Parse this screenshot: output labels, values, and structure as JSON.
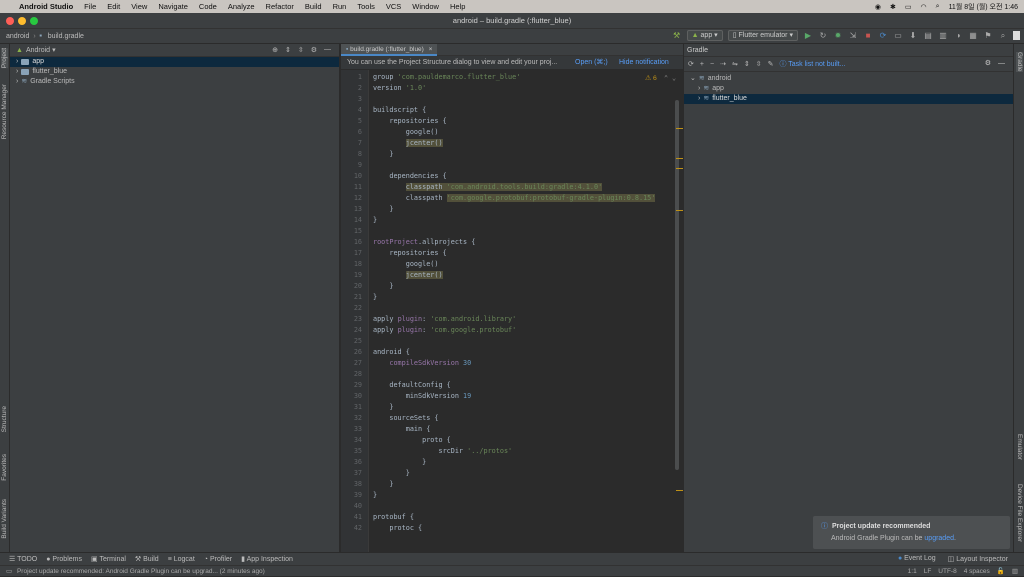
{
  "mac_menu": {
    "apple": "",
    "app_name": "Android Studio",
    "items": [
      "File",
      "Edit",
      "View",
      "Navigate",
      "Code",
      "Analyze",
      "Refactor",
      "Build",
      "Run",
      "Tools",
      "VCS",
      "Window",
      "Help"
    ],
    "datetime": "11월 8일 (월) 오전 1:46"
  },
  "window": {
    "title": "android – build.gradle (:flutter_blue)"
  },
  "navbar": {
    "breadcrumb_root": "android",
    "breadcrumb_file": "build.gradle",
    "run_config": "app",
    "device": "Flutter emulator"
  },
  "left_strip": {
    "project": "Project",
    "resource_manager": "Resource Manager",
    "structure": "Structure",
    "favorites": "Favorites",
    "build_variants": "Build Variants"
  },
  "right_strip": {
    "gradle": "Gradle",
    "emulator": "Emulator",
    "device_explorer": "Device File Explorer"
  },
  "project_panel": {
    "view": "Android",
    "tree": [
      {
        "label": "app",
        "selected": true
      },
      {
        "label": "flutter_blue",
        "selected": false
      },
      {
        "label": "Gradle Scripts",
        "selected": false
      }
    ]
  },
  "editor": {
    "tab": "build.gradle (:flutter_blue)",
    "banner_text": "You can use the Project Structure dialog to view and edit your proj...",
    "banner_open": "Open (⌘;)",
    "banner_hide": "Hide notification",
    "warnings": "⚠ 6",
    "line_numbers": [
      "1",
      "2",
      "3",
      "4",
      "5",
      "6",
      "7",
      "8",
      "9",
      "10",
      "11",
      "12",
      "13",
      "14",
      "15",
      "16",
      "17",
      "18",
      "19",
      "20",
      "21",
      "22",
      "23",
      "24",
      "25",
      "26",
      "27",
      "28",
      "29",
      "30",
      "31",
      "32",
      "33",
      "34",
      "35",
      "36",
      "37",
      "38",
      "39",
      "40",
      "41",
      "42"
    ],
    "code": {
      "l1a": "group ",
      "l1b": "'com.pauldemarco.flutter_blue'",
      "l2a": "version ",
      "l2b": "'1.0'",
      "l4": "buildscript {",
      "l5": "    repositories {",
      "l6": "        google()",
      "l7": "jcenter()",
      "l8": "    }",
      "l10": "    dependencies {",
      "l11a": "classpath ",
      "l11b": "'com.android.tools.build:gradle:4.1.0'",
      "l12a": "classpath ",
      "l12b": "'com.google.protobuf:protobuf-gradle-plugin:0.8.15'",
      "l13": "    }",
      "l14": "}",
      "l16a": "rootProject",
      "l16b": ".allprojects {",
      "l17": "    repositories {",
      "l18": "        google()",
      "l19": "jcenter()",
      "l20": "    }",
      "l21": "}",
      "l23a": "apply ",
      "l23b": "plugin",
      "l23c": ": ",
      "l23d": "'com.android.library'",
      "l24a": "apply ",
      "l24b": "plugin",
      "l24c": ": ",
      "l24d": "'com.google.protobuf'",
      "l26": "android {",
      "l27a": "    compileSdkVersion ",
      "l27b": "30",
      "l29": "    defaultConfig {",
      "l30a": "        minSdkVersion ",
      "l30b": "19",
      "l31": "    }",
      "l32": "    sourceSets {",
      "l33": "        main {",
      "l34": "            proto {",
      "l35a": "                srcDir ",
      "l35b": "'../protos'",
      "l36": "            }",
      "l37": "        }",
      "l38": "    }",
      "l39": "}",
      "l41": "protobuf {",
      "l42": "    protoc {"
    }
  },
  "gradle_panel": {
    "title": "Gradle",
    "task_list": "Task list not built...",
    "tree": [
      {
        "label": "android",
        "selected": false
      },
      {
        "label": "app",
        "selected": false
      },
      {
        "label": "flutter_blue",
        "selected": true
      }
    ]
  },
  "notification": {
    "title": "Project update recommended",
    "text": "Android Gradle Plugin can be ",
    "link": "upgraded",
    "end": "."
  },
  "bottom_tools": [
    "TODO",
    "Problems",
    "Terminal",
    "Build",
    "Logcat",
    "Profiler",
    "App Inspection"
  ],
  "bottom_right": [
    "Event Log",
    "Layout Inspector"
  ],
  "status": {
    "message": "Project update recommended: Android Gradle Plugin can be upgrad... (2 minutes ago)",
    "position": "1:1",
    "line_sep": "LF",
    "encoding": "UTF-8",
    "indent": "4 spaces"
  },
  "colors": {
    "accent": "#4a88c7",
    "selection": "#0d293e",
    "link": "#589df6",
    "warning": "#be9117"
  }
}
